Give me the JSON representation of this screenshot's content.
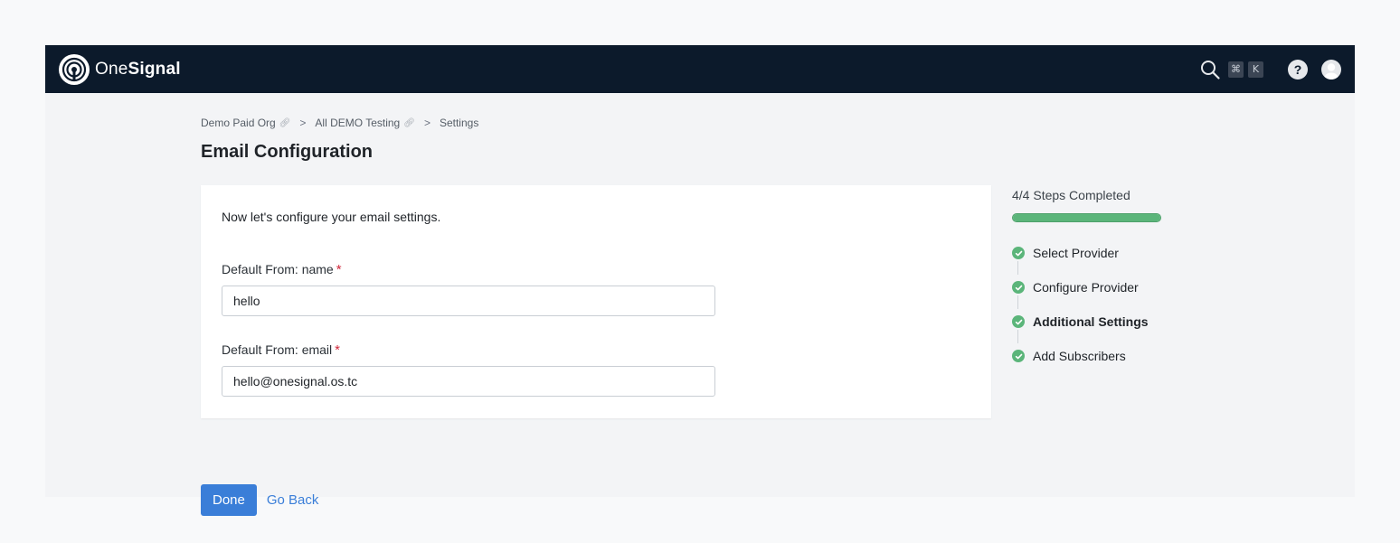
{
  "app": {
    "logo_light": "One",
    "logo_bold": "Signal",
    "shortcut_keys": [
      "⌘",
      "K"
    ],
    "help_label": "?"
  },
  "breadcrumb": {
    "items": [
      "Demo Paid Org",
      "All DEMO Testing",
      "Settings"
    ],
    "separator": ">"
  },
  "page": {
    "title": "Email Configuration"
  },
  "form": {
    "intro": "Now let's configure your email settings.",
    "from_name": {
      "label": "Default From: name",
      "required_mark": "*",
      "value": "hello"
    },
    "from_email": {
      "label": "Default From: email",
      "required_mark": "*",
      "value": "hello@onesignal.os.tc"
    }
  },
  "actions": {
    "done_label": "Done",
    "back_label": "Go Back"
  },
  "steps": {
    "title": "4/4 Steps Completed",
    "progress_fraction": 1.0,
    "items": [
      {
        "label": "Select Provider",
        "active": false
      },
      {
        "label": "Configure Provider",
        "active": false
      },
      {
        "label": "Additional Settings",
        "active": true
      },
      {
        "label": "Add Subscribers",
        "active": false
      }
    ]
  },
  "colors": {
    "topbar": "#0c1a2b",
    "accent": "#3a7ed8",
    "success": "#5bb57a",
    "required": "#d0283b"
  }
}
